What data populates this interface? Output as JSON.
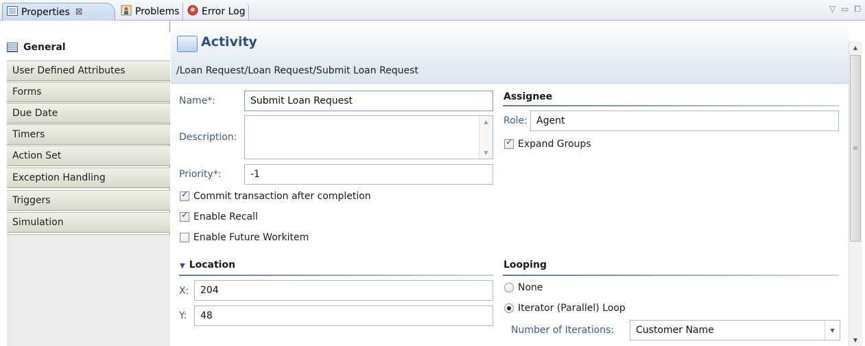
{
  "tabs": [
    {
      "label": "Properties",
      "active": true,
      "closable": true,
      "icon": "properties-icon"
    },
    {
      "label": "Problems",
      "icon": "problems-icon"
    },
    {
      "label": "Error Log",
      "icon": "error-log-icon"
    }
  ],
  "view_controls": {
    "view_menu": "▽",
    "minimize": "▭",
    "maximize": "⧠"
  },
  "sidebar": {
    "items": [
      {
        "label": "General",
        "active": true
      },
      {
        "label": "User Defined Attributes"
      },
      {
        "label": "Forms"
      },
      {
        "label": "Due Date"
      },
      {
        "label": "Timers"
      },
      {
        "label": "Action Set"
      },
      {
        "label": "Exception Handling"
      },
      {
        "label": "Triggers"
      },
      {
        "label": "Simulation"
      }
    ]
  },
  "header": {
    "title": "Activity",
    "breadcrumb": "/Loan Request/Loan Request/Submit Loan Request"
  },
  "form": {
    "name_label": "Name*:",
    "name_value": "Submit Loan Request",
    "description_label": "Description:",
    "description_value": "",
    "priority_label": "Priority*:",
    "priority_value": "-1",
    "commit_label": "Commit transaction after completion",
    "commit_checked": true,
    "recall_label": "Enable Recall",
    "recall_checked": true,
    "future_label": "Enable Future Workitem",
    "future_checked": false
  },
  "assignee": {
    "title": "Assignee",
    "role_label": "Role:",
    "role_value": "Agent",
    "expand_label": "Expand Groups",
    "expand_checked": true
  },
  "location": {
    "title": "Location",
    "x_label": "X:",
    "x_value": "204",
    "y_label": "Y:",
    "y_value": "48"
  },
  "looping": {
    "title": "Looping",
    "none_label": "None",
    "iterator_label": "Iterator (Parallel) Loop",
    "selected": "iterator",
    "iterations_label": "Number of Iterations:",
    "iterations_value": "Customer Name"
  },
  "colors": {
    "accent": "#2c4f86",
    "label": "#3b5b8b"
  }
}
